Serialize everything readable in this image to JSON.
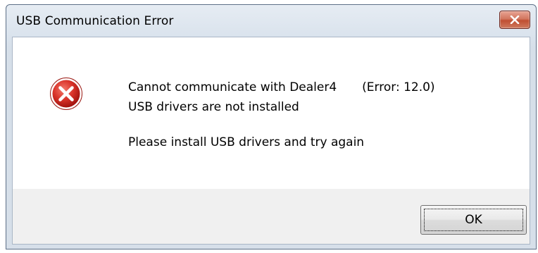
{
  "window": {
    "title": "USB Communication Error",
    "close_icon": "close-x-icon"
  },
  "message": {
    "line1": "Cannot communicate with Dealer4",
    "error_code": "(Error: 12.0)",
    "line2": "USB drivers are not installed",
    "line3": "Please install USB drivers and try again",
    "icon": "error-icon"
  },
  "buttons": {
    "ok_label": "OK"
  },
  "colors": {
    "close_button": "#c04f32",
    "error_icon": "#c8201b",
    "client_footer": "#f0f0f0"
  }
}
